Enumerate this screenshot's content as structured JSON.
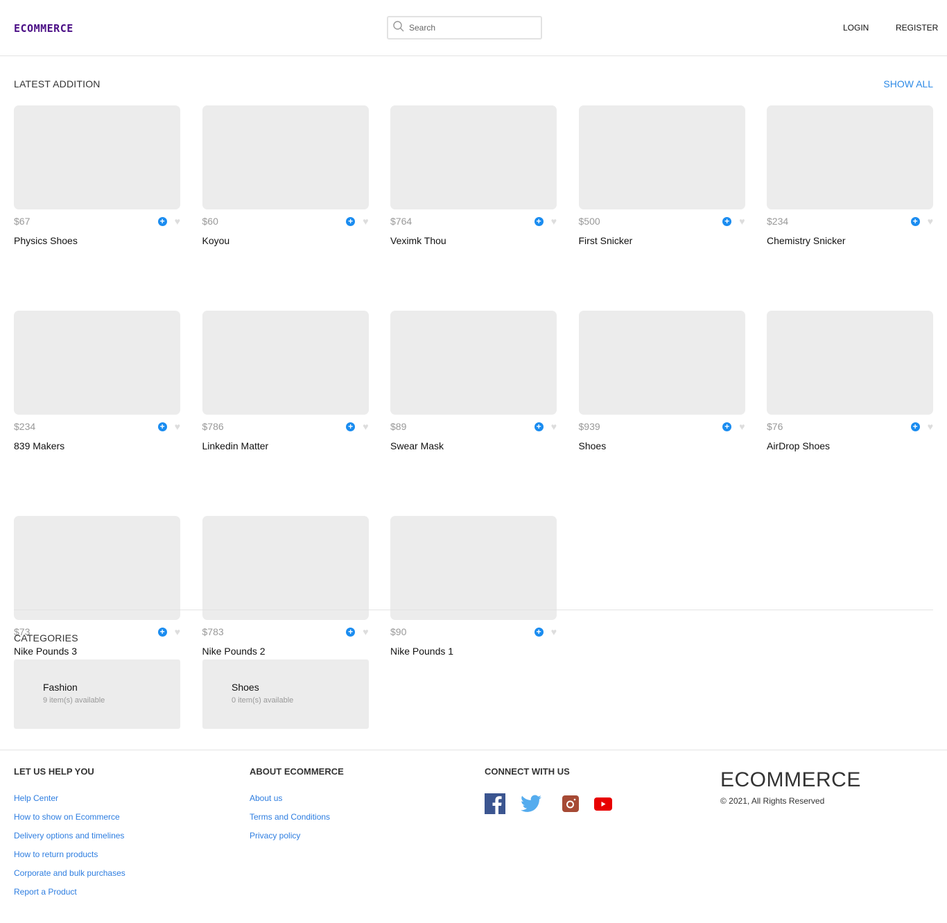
{
  "header": {
    "logo": "ECOMMERCE",
    "search_placeholder": "Search",
    "login": "LOGIN",
    "register": "REGISTER"
  },
  "latest": {
    "title": "LATEST ADDITION",
    "show_all": "SHOW ALL",
    "products": [
      {
        "price": "$67",
        "name": "Physics Shoes"
      },
      {
        "price": "$60",
        "name": "Koyou"
      },
      {
        "price": "$764",
        "name": "Veximk Thou"
      },
      {
        "price": "$500",
        "name": "First Snicker"
      },
      {
        "price": "$234",
        "name": "Chemistry Snicker"
      },
      {
        "price": "$234",
        "name": "839 Makers"
      },
      {
        "price": "$786",
        "name": "Linkedin Matter"
      },
      {
        "price": "$89",
        "name": "Swear Mask"
      },
      {
        "price": "$939",
        "name": "Shoes"
      },
      {
        "price": "$76",
        "name": "AirDrop Shoes"
      },
      {
        "price": "$73",
        "name": "Nike Pounds 3"
      },
      {
        "price": "$783",
        "name": "Nike Pounds 2"
      },
      {
        "price": "$90",
        "name": "Nike Pounds 1"
      }
    ]
  },
  "categories": {
    "title": "CATEGORIES",
    "items": [
      {
        "name": "Fashion",
        "count": "9 item(s) available"
      },
      {
        "name": "Shoes",
        "count": "0 item(s) available"
      }
    ]
  },
  "footer": {
    "help": {
      "title": "LET US HELP YOU",
      "links": [
        "Help Center",
        "How to show on Ecommerce",
        "Delivery options and timelines",
        "How to return products",
        "Corporate and bulk purchases",
        "Report a Product"
      ]
    },
    "about": {
      "title": "ABOUT ECOMMERCE",
      "links": [
        "About us",
        "Terms and Conditions",
        "Privacy policy"
      ]
    },
    "connect": {
      "title": "CONNECT WITH US"
    },
    "brand": "ECOMMERCE",
    "copyright": "© 2021, All Rights Reserved",
    "colors": {
      "facebook": "#3b5590",
      "twitter": "#55acee",
      "instagram": "#a64a35",
      "youtube": "#e80000"
    }
  }
}
